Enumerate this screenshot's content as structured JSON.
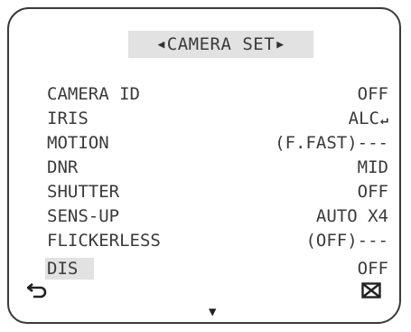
{
  "menu": {
    "title": "CAMERA SET",
    "prev_arrow": "◀",
    "next_arrow": "▶",
    "items": [
      {
        "label": "CAMERA ID",
        "value": "OFF"
      },
      {
        "label": "IRIS",
        "value": "ALC"
      },
      {
        "label": "MOTION",
        "value": "(F.FAST)---"
      },
      {
        "label": "DNR",
        "value": "MID"
      },
      {
        "label": "SHUTTER",
        "value": "OFF"
      },
      {
        "label": "SENS-UP",
        "value": "AUTO X4"
      },
      {
        "label": "FLICKERLESS",
        "value": "(OFF)---"
      },
      {
        "label": "DIS",
        "value": "OFF"
      }
    ],
    "selected_item": "DIS"
  },
  "icons": {
    "iris_enter": "enter-arrow-icon",
    "back": "return-icon",
    "close": "boxed-x-icon",
    "more": "down-triangle-icon"
  }
}
